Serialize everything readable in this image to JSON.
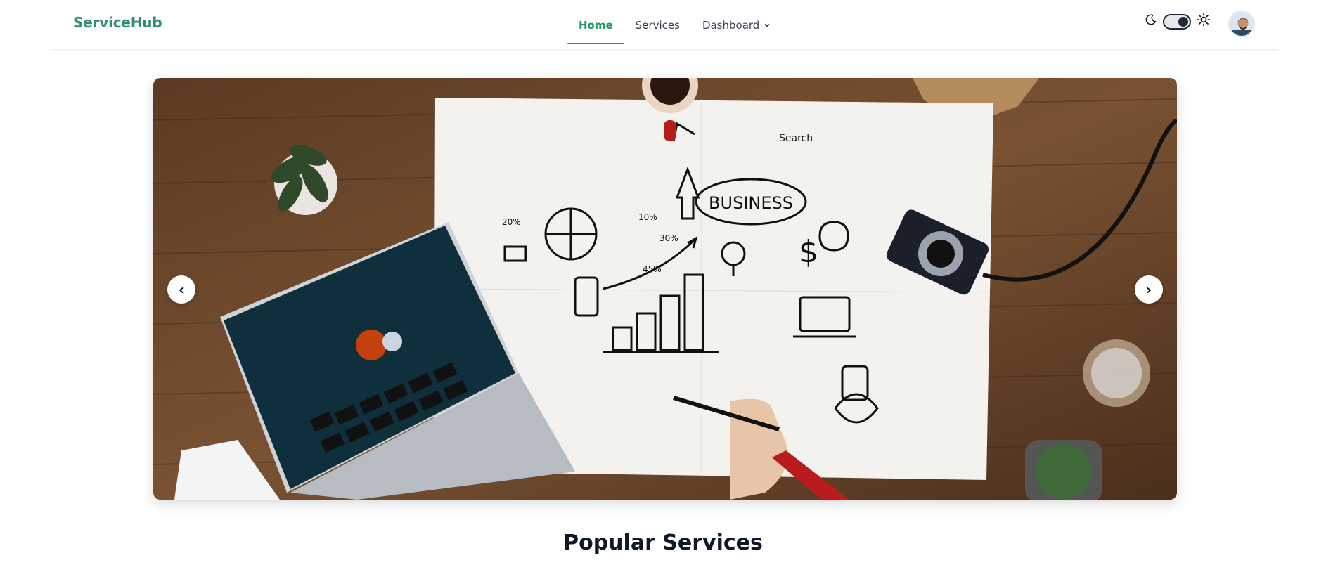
{
  "brand": "ServiceHub",
  "nav": {
    "home": "Home",
    "services": "Services",
    "dashboard": "Dashboard"
  },
  "theme": {
    "moon_icon": "moon-icon",
    "sun_icon": "sun-icon",
    "mode": "dark"
  },
  "hero": {
    "image": "Desk with laptop and business sketch",
    "prev_label": "‹",
    "next_label": "›",
    "sketch_texts": {
      "business": "BUSINESS",
      "search": "Search",
      "p20": "20%",
      "p10": "10%",
      "p30": "30%",
      "p45": "45%"
    }
  },
  "section": {
    "title": "Popular Services"
  },
  "colors": {
    "brand": "#2f8f6b",
    "active": "#1f9a63"
  }
}
